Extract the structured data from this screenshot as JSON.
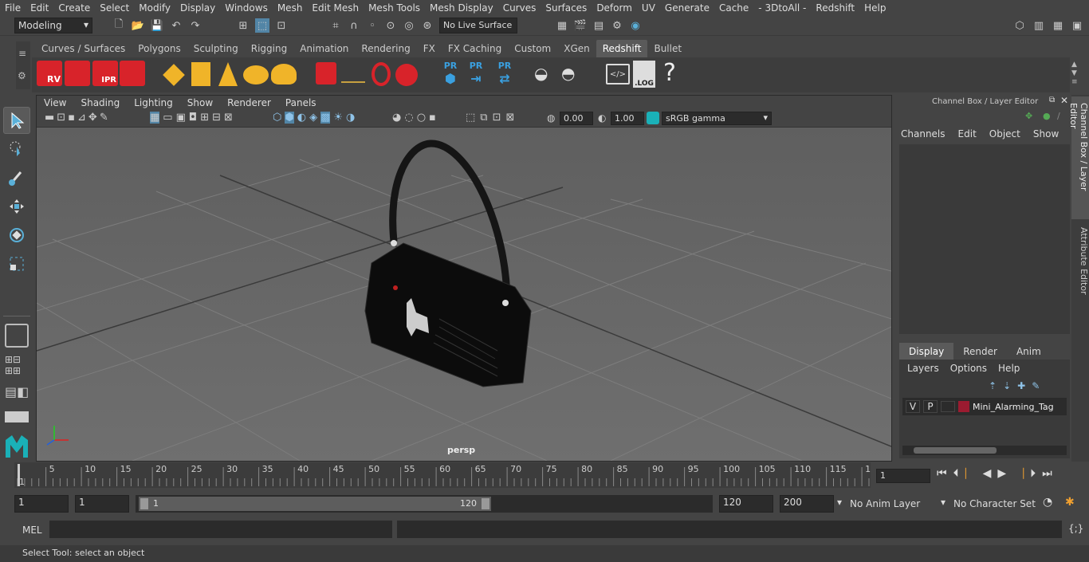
{
  "menu": [
    "File",
    "Edit",
    "Create",
    "Select",
    "Modify",
    "Display",
    "Windows",
    "Mesh",
    "Edit Mesh",
    "Mesh Tools",
    "Mesh Display",
    "Curves",
    "Surfaces",
    "Deform",
    "UV",
    "Generate",
    "Cache",
    "- 3DtoAll -",
    "Redshift",
    "Help"
  ],
  "status": {
    "mode": "Modeling",
    "live_surface": "No Live Surface"
  },
  "shelf_tabs": [
    "Curves / Surfaces",
    "Polygons",
    "Sculpting",
    "Rigging",
    "Animation",
    "Rendering",
    "FX",
    "FX Caching",
    "Custom",
    "XGen",
    "Redshift",
    "Bullet"
  ],
  "active_shelf": "Redshift",
  "shelf_icon_labels": {
    "rv": "RV",
    "ipr": "IPR",
    "pr": "PR",
    "log": ".LOG",
    "help": "?"
  },
  "viewport": {
    "menu": [
      "View",
      "Shading",
      "Lighting",
      "Show",
      "Renderer",
      "Panels"
    ],
    "exposure": "0.00",
    "gamma": "1.00",
    "color_space": "sRGB gamma",
    "camera_label": "persp"
  },
  "channel_box": {
    "title": "Channel Box / Layer Editor",
    "menu": [
      "Channels",
      "Edit",
      "Object",
      "Show"
    ],
    "layer_tabs": [
      "Display",
      "Render",
      "Anim"
    ],
    "active_layer_tab": "Display",
    "layer_menu": [
      "Layers",
      "Options",
      "Help"
    ],
    "layer": {
      "v": "V",
      "p": "P",
      "name": "Mini_Alarming_Tag",
      "color": "#9b1b30"
    }
  },
  "side_tabs": {
    "channel_box": "Channel Box / Layer Editor",
    "attribute_editor": "Attribute Editor"
  },
  "timeline": {
    "ticks": [
      "1",
      "5",
      "10",
      "15",
      "20",
      "25",
      "30",
      "35",
      "40",
      "45",
      "50",
      "55",
      "60",
      "65",
      "70",
      "75",
      "80",
      "85",
      "90",
      "95",
      "100",
      "105",
      "110",
      "115",
      "12"
    ],
    "current_frame": "1"
  },
  "range": {
    "start": "1",
    "playback_start": "1",
    "slider_start": "1",
    "slider_end": "120",
    "playback_end": "120",
    "end": "200",
    "anim_layer": "No Anim Layer",
    "character_set": "No Character Set"
  },
  "command": {
    "label": "MEL"
  },
  "help_line": "Select Tool: select an object",
  "colors": {
    "accent": "#5285a6",
    "redshift_red": "#d8232a",
    "shelf_yellow": "#f0b429",
    "pr_blue": "#3aa0e0"
  }
}
